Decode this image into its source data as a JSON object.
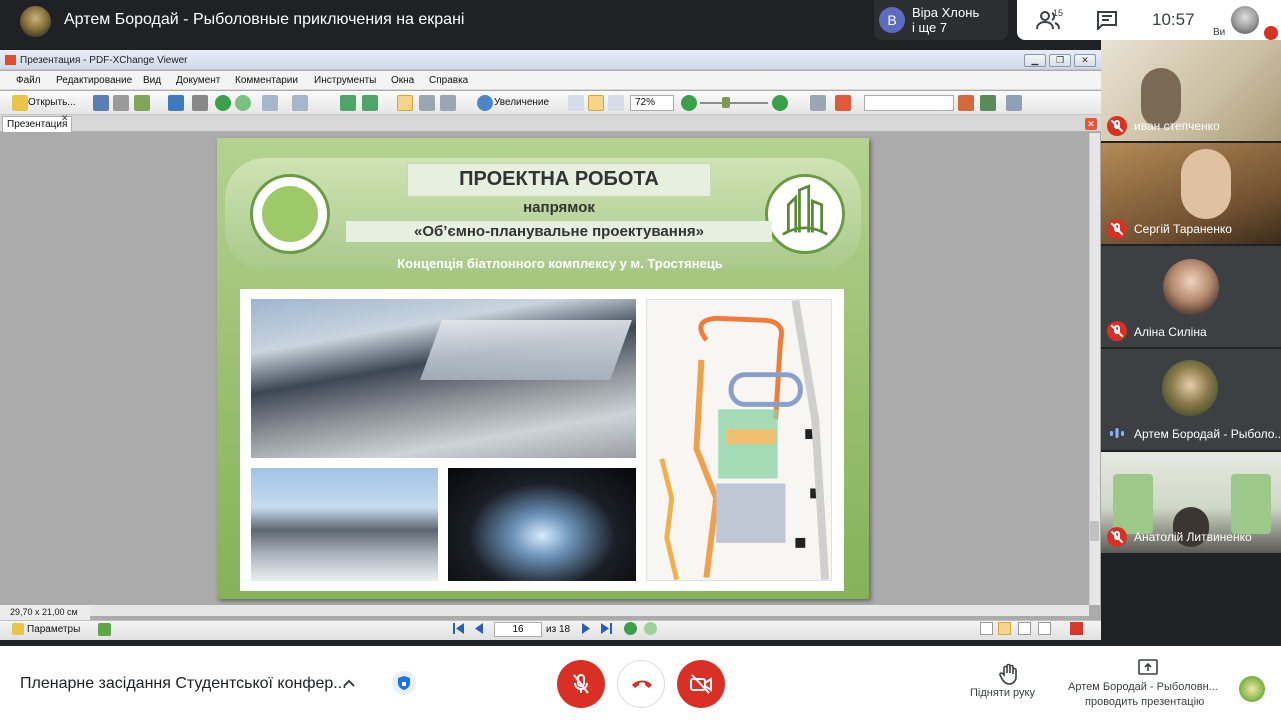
{
  "topbar": {
    "meeting_title": "Артем Бородай - Рыболовные приключения на екрані",
    "chip": {
      "avatar_letter": "В",
      "name": "Віра Хлонь",
      "more": "і ще 7"
    },
    "people_count": "15",
    "clock": "10:57",
    "self_label": "Ви"
  },
  "viewer": {
    "title": "Презентация - PDF-XChange Viewer",
    "menu": [
      "Файл",
      "Редактирование",
      "Вид",
      "Документ",
      "Комментарии",
      "Инструменты",
      "Окна",
      "Справка"
    ],
    "toolbar": {
      "open_label": "Открыть...",
      "zoom_tool_label": "Увеличение",
      "zoom_value": "72%"
    },
    "tab_label": "Презентация",
    "page_size": "29,70 x 21,00 см",
    "params_label": "Параметры",
    "current_page": "16",
    "page_of": "из 18",
    "window_buttons": [
      "▁",
      "❐",
      "✕"
    ]
  },
  "slide": {
    "title": "ПРОЕКТНА РОБОТА",
    "sub1": "напрямок",
    "sub2": "«Об’ємно-планувальне проектування»",
    "sub3": "Концепція біатлонного комплексу у м. Тростянець"
  },
  "participants": [
    {
      "name": "иван степченко",
      "muted": true
    },
    {
      "name": "Сергій Тараненко",
      "muted": true
    },
    {
      "name": "Аліна Силіна",
      "muted": true
    },
    {
      "name": "Артем Бородай - Рыболо...",
      "muted": false
    },
    {
      "name": "Анатолій Литвиненко",
      "muted": true
    }
  ],
  "bottombar": {
    "meeting_name": "Пленарне засідання Студентської конфер...",
    "raise_hand": "Підняти руку",
    "presenting_line1": "Артем Бородай - Рыболовн...",
    "presenting_line2": "проводить презентацію"
  },
  "colors": {
    "accent_red": "#d93025",
    "meet_dark": "#202124",
    "slide_green": "#96bd6c"
  }
}
